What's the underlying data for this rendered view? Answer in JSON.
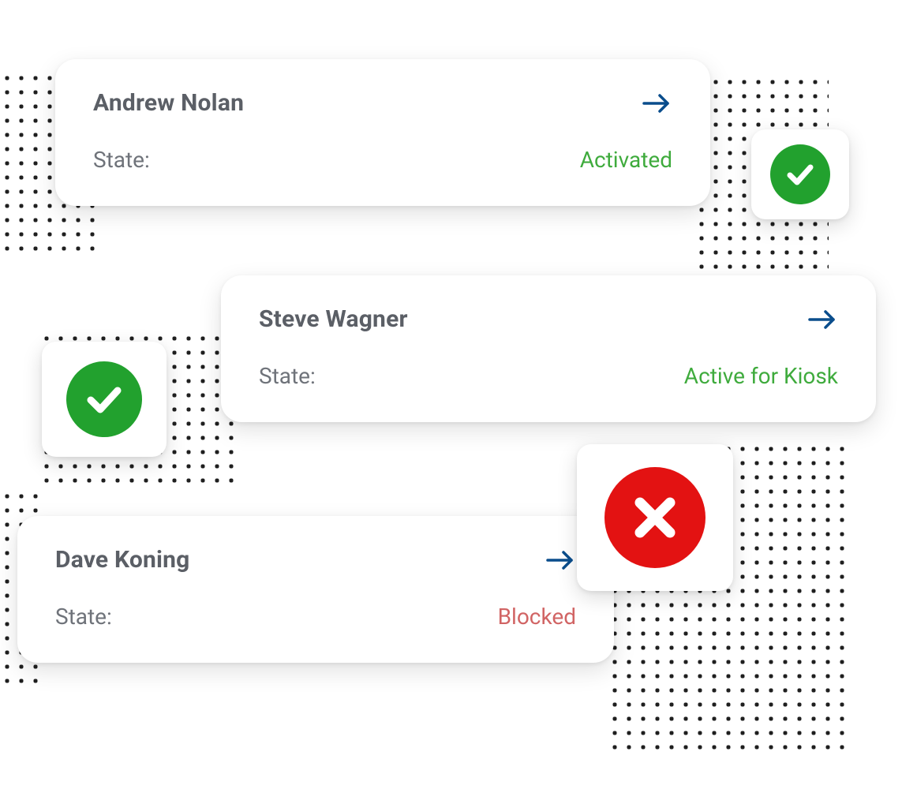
{
  "state_label": "State:",
  "colors": {
    "accent_blue": "#0a4d8c",
    "success_green": "#3fab3d",
    "check_green": "#22a12e",
    "error_red": "#e31212",
    "blocked_red": "#d16464"
  },
  "cards": [
    {
      "name": "Andrew Nolan",
      "state": "Activated",
      "state_kind": "active"
    },
    {
      "name": "Steve Wagner",
      "state": "Active for Kiosk",
      "state_kind": "active"
    },
    {
      "name": "Dave Koning",
      "state": "Blocked",
      "state_kind": "blocked"
    }
  ],
  "badges": [
    {
      "icon": "check-icon",
      "kind": "success"
    },
    {
      "icon": "check-icon",
      "kind": "success"
    },
    {
      "icon": "cross-icon",
      "kind": "error"
    }
  ]
}
